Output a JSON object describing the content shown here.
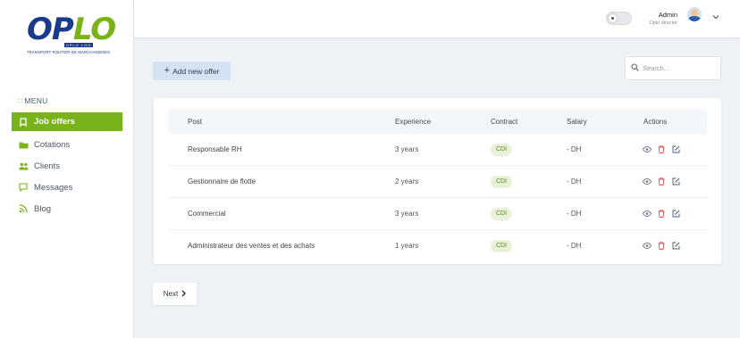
{
  "brand": {
    "logo_op": "OP",
    "logo_lo": "LO",
    "logo_bar": "OPLO LOG",
    "tagline": "TRANSPORT ROUTIER DE MARCHANDISES"
  },
  "sidebar": {
    "menu_label": "MENU",
    "items": [
      {
        "label": "Job offers",
        "icon": "bookmark-icon",
        "active": true
      },
      {
        "label": "Cotations",
        "icon": "folder-icon",
        "active": false
      },
      {
        "label": "Clients",
        "icon": "users-icon",
        "active": false
      },
      {
        "label": "Messages",
        "icon": "chat-icon",
        "active": false
      },
      {
        "label": "Blog",
        "icon": "rss-icon",
        "active": false
      }
    ]
  },
  "header": {
    "user_name": "Admin",
    "user_role": "Oplo director"
  },
  "toolbar": {
    "add_label": "Add new offer",
    "search_placeholder": "Search..."
  },
  "table": {
    "columns": [
      "Post",
      "Experience",
      "Contract",
      "Salary",
      "Actions"
    ],
    "rows": [
      {
        "post": "Responsable RH",
        "experience": "3 years",
        "contract": "CDI",
        "salary": "- DH"
      },
      {
        "post": "Gestionnaire de flotte",
        "experience": "2 years",
        "contract": "CDI",
        "salary": "- DH"
      },
      {
        "post": "Commercial",
        "experience": "3 years",
        "contract": "CDI",
        "salary": "- DH"
      },
      {
        "post": "Administrateur des ventes et des achats",
        "experience": "1 years",
        "contract": "CDI",
        "salary": "- DH"
      }
    ]
  },
  "pagination": {
    "next_label": "Next"
  },
  "colors": {
    "accent": "#78b31b",
    "brand_blue": "#1a3a8c",
    "delete": "#e05252"
  }
}
